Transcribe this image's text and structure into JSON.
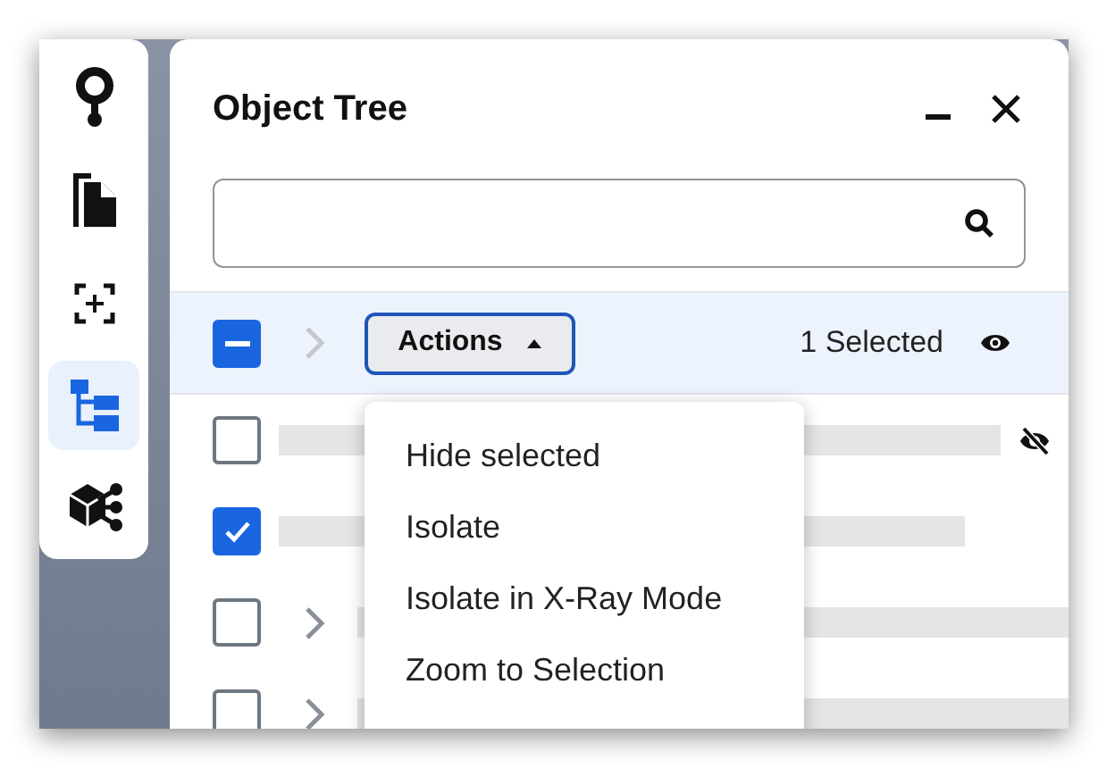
{
  "sidebar": {
    "items": [
      {
        "kind": "pin",
        "selected": false
      },
      {
        "kind": "documents",
        "selected": false
      },
      {
        "kind": "focus",
        "selected": false
      },
      {
        "kind": "tree",
        "selected": true
      },
      {
        "kind": "model",
        "selected": false
      }
    ]
  },
  "panel": {
    "title": "Object Tree"
  },
  "selection_bar": {
    "checkbox": {
      "mixed": true
    },
    "actions_button": {
      "label": "Actions",
      "expanded": true
    },
    "count": "1 Selected"
  },
  "rows": [
    {
      "checked": false,
      "expandable": false,
      "hidden": true
    },
    {
      "checked": true,
      "expandable": false,
      "hidden": false
    },
    {
      "checked": false,
      "expandable": true,
      "hidden": false
    },
    {
      "checked": false,
      "expandable": true,
      "hidden": false
    }
  ],
  "menu": {
    "items": [
      "Hide selected",
      "Isolate",
      "Isolate in X-Ray Mode",
      "Zoom to Selection"
    ]
  }
}
